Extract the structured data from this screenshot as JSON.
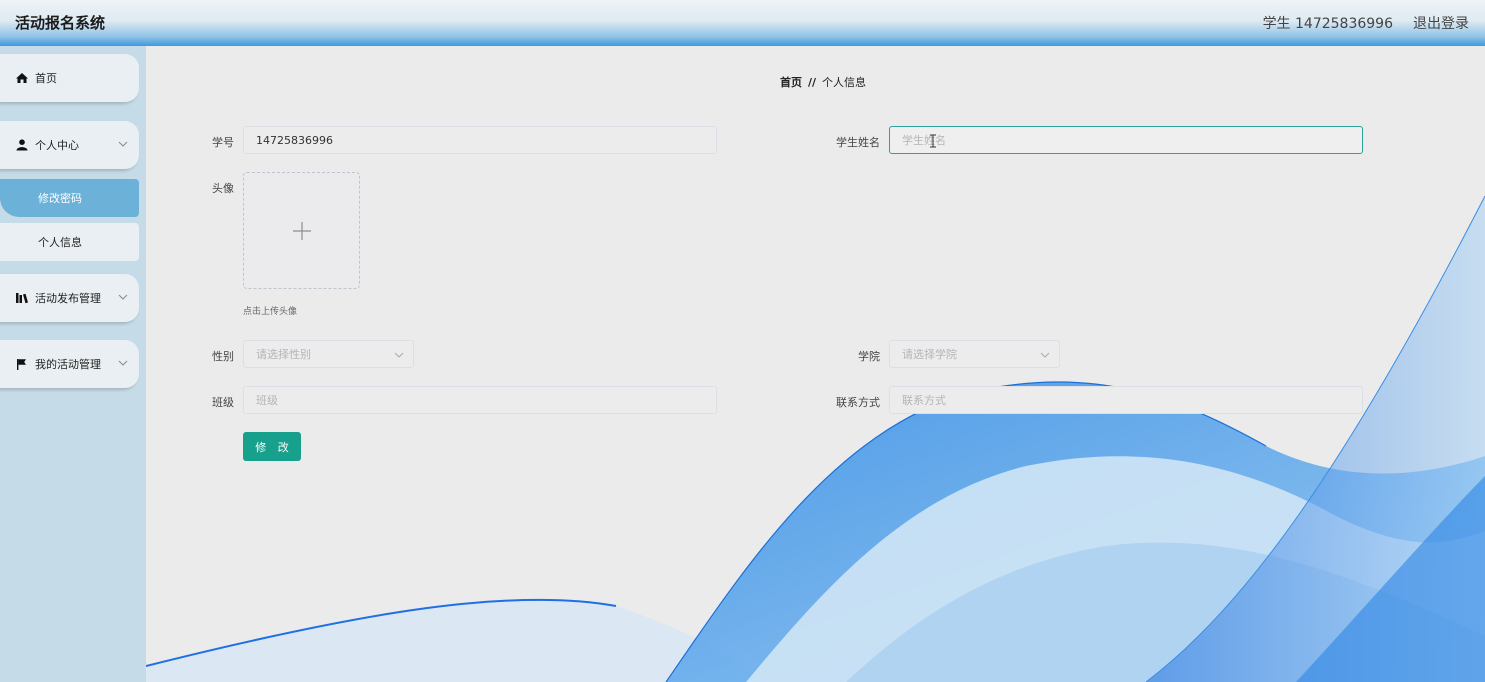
{
  "header": {
    "title": "活动报名系统",
    "user": "学生 14725836996",
    "logout": "退出登录"
  },
  "sidebar": {
    "items": [
      {
        "label": "首页",
        "icon": "home-icon"
      },
      {
        "label": "个人中心",
        "icon": "user-icon",
        "expanded": true,
        "children": [
          {
            "label": "修改密码",
            "active": true
          },
          {
            "label": "个人信息",
            "active": false
          }
        ]
      },
      {
        "label": "活动发布管理",
        "icon": "library-icon"
      },
      {
        "label": "我的活动管理",
        "icon": "flag-icon"
      }
    ]
  },
  "breadcrumb": {
    "home": "首页",
    "separator": "//",
    "current": "个人信息"
  },
  "form": {
    "student_id": {
      "label": "学号",
      "value": "14725836996"
    },
    "student_name": {
      "label": "学生姓名",
      "placeholder": "学生姓名"
    },
    "avatar": {
      "label": "头像",
      "tip": "点击上传头像"
    },
    "gender": {
      "label": "性别",
      "placeholder": "请选择性别"
    },
    "college": {
      "label": "学院",
      "placeholder": "请选择学院"
    },
    "class": {
      "label": "班级",
      "placeholder": "班级"
    },
    "contact": {
      "label": "联系方式",
      "placeholder": "联系方式"
    },
    "submit": "修 改"
  },
  "colors": {
    "accent": "#17a08b",
    "sidebar_active": "#6cb1d8",
    "focus_border": "#2ba39a"
  }
}
